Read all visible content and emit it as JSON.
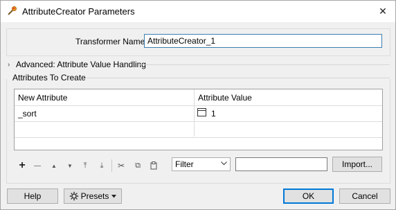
{
  "window": {
    "title": "AttributeCreator Parameters",
    "icon": "transformer-icon",
    "close_glyph": "✕"
  },
  "transformer": {
    "label": "Transformer Name:",
    "value": "AttributeCreator_1"
  },
  "advanced": {
    "label": "Advanced: Attribute Value Handling",
    "chevron": "›"
  },
  "section": {
    "label": "Attributes To Create"
  },
  "table": {
    "headers": [
      "New Attribute",
      "Attribute Value"
    ],
    "rows": [
      {
        "attribute": "_sort",
        "value": "1"
      }
    ]
  },
  "toolbar": {
    "add": "+",
    "remove": "—",
    "up": "▲",
    "down": "▼",
    "top": "⤒",
    "bottom": "⤓",
    "cut": "✂",
    "copy": "⧉",
    "paste": "📋",
    "filter_value": "Filter",
    "filter_text": "",
    "import_label": "Import..."
  },
  "footer": {
    "help_label": "Help",
    "presets_label": "Presets",
    "ok_label": "OK",
    "cancel_label": "Cancel"
  }
}
